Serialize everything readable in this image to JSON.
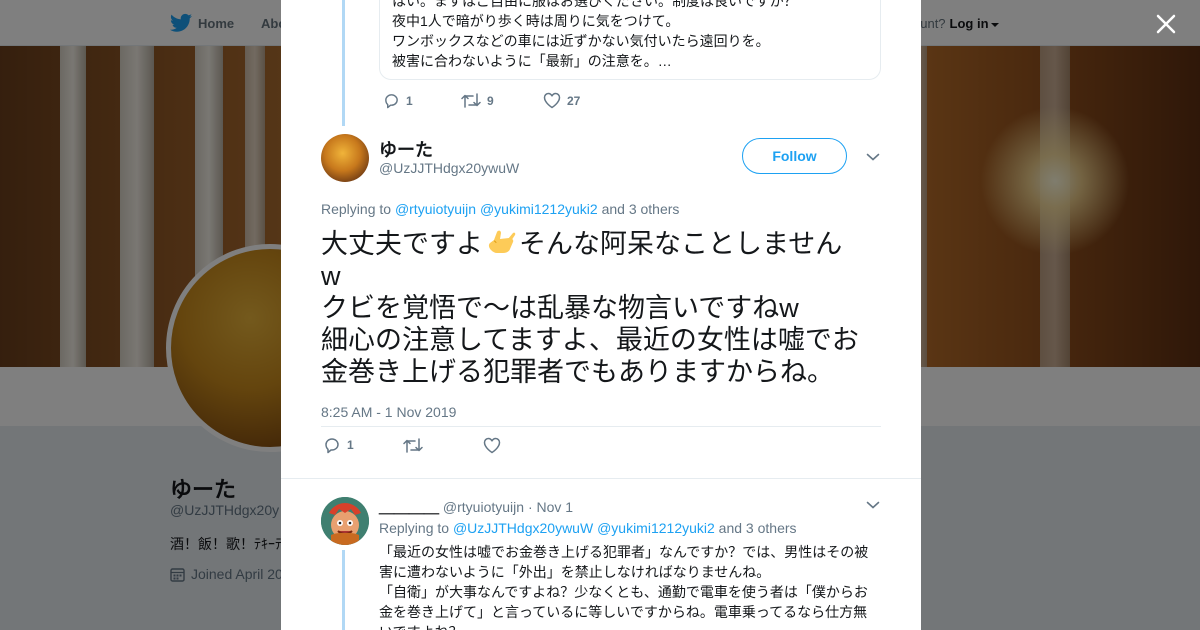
{
  "nav": {
    "home": "Home",
    "about": "Abo",
    "account_q": "ccount?",
    "login": "Log in"
  },
  "profile": {
    "name": "ゆーた",
    "handle": "@UzJJTHdgx20y",
    "bio": "酒！飯！歌！ﾃｷｰﾃ",
    "joined": "Joined April 20"
  },
  "prev_tweet": {
    "lines": [
      "はい。ますはご自由に服はお選びください。制度は良いですか？",
      "夜中1人で暗がり歩く時は周りに気をつけて。",
      "ワンボックスなどの車には近ずかない気付いたら遠回りを。",
      "被害に合わないように「最新」の注意を。…"
    ],
    "reply_count": "1",
    "retweet_count": "9",
    "like_count": "27"
  },
  "main_tweet": {
    "name": "ゆーた",
    "handle": "@UzJJTHdgx20ywuW",
    "follow_label": "Follow",
    "replying_prefix": "Replying to ",
    "replying_user1": "@rtyuiotyuijn",
    "replying_user2": "@yukimi1212yuki2",
    "replying_suffix": " and 3 others",
    "text_before_emoji": "大丈夫ですよ",
    "text_after_emoji": "そんな阿呆なことしません\nw\nクビを覚悟で〜は乱暴な物言いですねw\n細心の注意してますよ、最近の女性は嘘でお\n金巻き上げる犯罪者でもありますからね。",
    "timestamp": "8:25 AM - 1 Nov 2019",
    "reply_count": "1"
  },
  "reply_tweet": {
    "name": "＿＿＿＿",
    "handle": "@rtyuiotyuijn",
    "date": "· Nov 1",
    "replying_prefix": "Replying to ",
    "replying_user1": "@UzJJTHdgx20ywuW",
    "replying_user2": "@yukimi1212yuki2",
    "replying_suffix": " and 3 others",
    "lines": [
      "「最近の女性は嘘でお金巻き上げる犯罪者」なんですか？では、男性はその被",
      "害に遭わないように「外出」を禁止しなければなりませんね。",
      "「自衛」が大事なんですよね？少なくとも、通勤で電車を使う者は「僕からお",
      "金を巻き上げて」と言っているに等しいですからね。電車乗ってるなら仕方無",
      "いですよね？"
    ]
  },
  "colors": {
    "accent": "#1da1f2",
    "thread_line": "#b1d8f5",
    "muted_text": "#657786"
  }
}
